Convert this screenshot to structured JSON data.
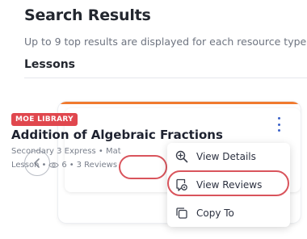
{
  "header": {
    "title": "Search Results",
    "subtitle": "Up to 9 top results are displayed for each resource type.",
    "section": "Lessons"
  },
  "card": {
    "badge": "MOE LIBRARY",
    "title": "Addition of Algebraic Fractions",
    "meta_line1": "Secondary 3 Express • Mat",
    "type": "Lesson",
    "separator": "•",
    "views": "6",
    "reviews": "3 Reviews",
    "accent_color": "#f07a2e",
    "badge_color": "#e0474e"
  },
  "menu": {
    "items": [
      {
        "label": "View Details",
        "icon": "search-plus-icon"
      },
      {
        "label": "View Reviews",
        "icon": "review-icon"
      },
      {
        "label": "Copy To",
        "icon": "copy-icon"
      }
    ]
  },
  "colors": {
    "highlight": "#d9545c",
    "link": "#3b62c8"
  }
}
